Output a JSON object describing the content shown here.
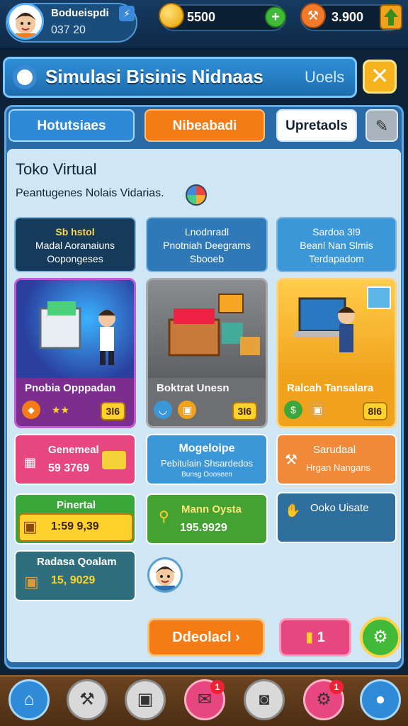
{
  "hud": {
    "player_name": "Bodueispdi",
    "player_level": "037 20",
    "coins": "5500",
    "gems": "3.900"
  },
  "titlebar": {
    "title": "Simulasi Bisinis Nidnaas",
    "subtitle": "Uoels",
    "close_label": "✕"
  },
  "tabs": [
    "Hotutsiaes",
    "Nibeabadi",
    "Upretaols"
  ],
  "store": {
    "title": "Toko Virtual",
    "subtitle": "Peantugenes Nolais Vidarias."
  },
  "info_boxes": [
    {
      "l1": "Sb hstol",
      "l2": "Madal Aoranaiuns",
      "l3": "Oopongeses"
    },
    {
      "l1": "Lnodnradl",
      "l2": "Pnotniah Deegrams",
      "l3": "Sbooeb"
    },
    {
      "l1": "Sardoa 3l9",
      "l2": "Beanl Nan Slmis",
      "l3": "Terdapadom"
    }
  ],
  "cards": [
    {
      "name": "Pnobia Opppadan",
      "value": "3l6"
    },
    {
      "name": "Boktrat Unesn",
      "value": "3l6"
    },
    {
      "name": "Ralcah Tansalara",
      "value": "8l6"
    }
  ],
  "tiles": [
    {
      "name": "Genemeal",
      "value": "59 3769"
    },
    {
      "name": "Mogeloipe",
      "value": "Pebitulain Shsardedos",
      "extra": "Bunsg Oooseen"
    },
    {
      "name": "Sarudaal",
      "value": "Hrgan Nangans"
    },
    {
      "name": "Pinertal",
      "value": "1:59 9,39"
    },
    {
      "name": "Mann Oysta",
      "value": "195.9929"
    },
    {
      "name": "Ooko Uisate",
      "value": ""
    },
    {
      "name": "Radasa Qoalam",
      "value": "15, 9029"
    }
  ],
  "buttons": {
    "go": "Ddeolacl ›",
    "pink_count": "1"
  },
  "nav_badges": [
    "1",
    "1"
  ]
}
